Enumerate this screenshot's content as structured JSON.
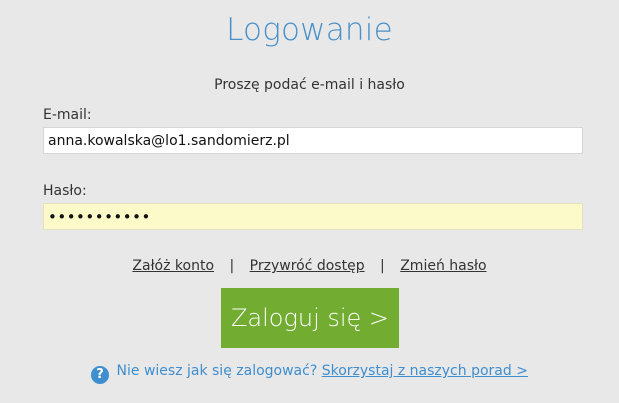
{
  "title": "Logowanie",
  "subtitle": "Proszę podać e-mail i hasło",
  "email": {
    "label": "E-mail:",
    "value": "anna.kowalska@lo1.sandomierz.pl"
  },
  "password": {
    "label": "Hasło:",
    "masked_value": "•••••••••••"
  },
  "links": {
    "create_account": "Załóż konto",
    "separator": "|",
    "restore_access": "Przywróć dostęp",
    "change_password": "Zmień hasło"
  },
  "login_button": "Zaloguj się >",
  "help": {
    "icon": "question-circle-icon",
    "icon_glyph": "?",
    "question": "Nie wiesz jak się zalogować?",
    "link": "Skorzystaj z naszych porad >"
  },
  "colors": {
    "background": "#e8e8e8",
    "title": "#4a90c8",
    "button": "#72ad32",
    "password_field": "#fdfac9",
    "help": "#3e8ed0"
  }
}
